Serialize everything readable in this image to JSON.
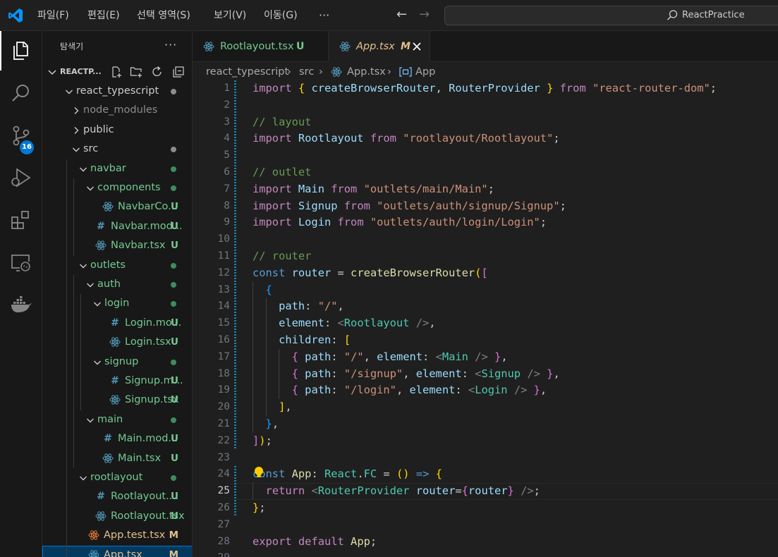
{
  "menu": {
    "items": [
      "파일(F)",
      "편집(E)",
      "선택 영역(S)",
      "보기(V)",
      "이동(G)"
    ],
    "more": "···",
    "back_arrow": "←",
    "forward_arrow": "→",
    "search_text": "ReactPractice"
  },
  "activity": {
    "scm_badge": "16"
  },
  "explorer": {
    "title": "탐색기",
    "more": "···",
    "workspace": "REACTP...",
    "items": [
      {
        "label": "react_typescript",
        "kind": "folder",
        "open": true,
        "status": "dot",
        "color": "#cccccc"
      },
      {
        "label": "node_modules",
        "kind": "folder",
        "open": false,
        "status": "",
        "color": "#8c8c8c"
      },
      {
        "label": "public",
        "kind": "folder",
        "open": false,
        "status": "",
        "color": "#cccccc"
      },
      {
        "label": "src",
        "kind": "folder",
        "open": true,
        "status": "dot",
        "color": "#cccccc"
      },
      {
        "label": "navbar",
        "kind": "folder",
        "open": true,
        "status": "dot-green",
        "color": "#73c991"
      },
      {
        "label": "components",
        "kind": "folder",
        "open": true,
        "status": "dot-green",
        "color": "#73c991"
      },
      {
        "label": "NavbarCo...",
        "kind": "react",
        "status": "U",
        "color": "#73c991"
      },
      {
        "label": "Navbar.mod...",
        "kind": "css",
        "status": "U",
        "color": "#73c991"
      },
      {
        "label": "Navbar.tsx",
        "kind": "react",
        "status": "U",
        "color": "#73c991"
      },
      {
        "label": "outlets",
        "kind": "folder",
        "open": true,
        "status": "dot-green",
        "color": "#73c991"
      },
      {
        "label": "auth",
        "kind": "folder",
        "open": true,
        "status": "dot-green",
        "color": "#73c991"
      },
      {
        "label": "login",
        "kind": "folder",
        "open": true,
        "status": "dot-green",
        "color": "#73c991"
      },
      {
        "label": "Login.mo...",
        "kind": "css",
        "status": "U",
        "color": "#73c991"
      },
      {
        "label": "Login.tsx",
        "kind": "react",
        "status": "U",
        "color": "#73c991"
      },
      {
        "label": "signup",
        "kind": "folder",
        "open": true,
        "status": "dot-green",
        "color": "#73c991"
      },
      {
        "label": "Signup.m...",
        "kind": "css",
        "status": "U",
        "color": "#73c991"
      },
      {
        "label": "Signup.tsx",
        "kind": "react",
        "status": "U",
        "color": "#73c991"
      },
      {
        "label": "main",
        "kind": "folder",
        "open": true,
        "status": "dot-green",
        "color": "#73c991"
      },
      {
        "label": "Main.mod...",
        "kind": "css",
        "status": "U",
        "color": "#73c991"
      },
      {
        "label": "Main.tsx",
        "kind": "react",
        "status": "U",
        "color": "#73c991"
      },
      {
        "label": "rootlayout",
        "kind": "folder",
        "open": true,
        "status": "dot-green",
        "color": "#73c991"
      },
      {
        "label": "Rootlayout....",
        "kind": "css",
        "status": "U",
        "color": "#73c991"
      },
      {
        "label": "Rootlayout.tsx",
        "kind": "react",
        "status": "U",
        "color": "#73c991"
      },
      {
        "label": "App.test.tsx",
        "kind": "test",
        "status": "M",
        "color": "#e2c08d"
      },
      {
        "label": "App.tsx",
        "kind": "react",
        "status": "M",
        "color": "#e2c08d",
        "selected": true
      }
    ]
  },
  "tabs": [
    {
      "name": "Rootlayout.tsx",
      "flag": "U",
      "active": false
    },
    {
      "name": "App.tsx",
      "flag": "M",
      "active": true
    }
  ],
  "breadcrumb": [
    "react_typescript",
    "src",
    "App.tsx",
    "App"
  ],
  "editor": {
    "current_line": 25,
    "lines": [
      [
        [
          "kw",
          "import"
        ],
        [
          "",
          "&nbsp;"
        ],
        [
          "b1",
          "{"
        ],
        [
          "",
          " "
        ],
        [
          "var",
          "createBrowserRouter"
        ],
        [
          "",
          ", "
        ],
        [
          "var",
          "RouterProvider"
        ],
        [
          "",
          " "
        ],
        [
          "b1",
          "}"
        ],
        [
          "",
          " "
        ],
        [
          "kw",
          "from"
        ],
        [
          "",
          " "
        ],
        [
          "str",
          "\"react-router-dom\""
        ],
        [
          "",
          ";"
        ]
      ],
      [],
      [
        [
          "cm",
          "// layout"
        ]
      ],
      [
        [
          "kw",
          "import"
        ],
        [
          "",
          " "
        ],
        [
          "var",
          "Rootlayout"
        ],
        [
          "",
          " "
        ],
        [
          "kw",
          "from"
        ],
        [
          "",
          " "
        ],
        [
          "str",
          "\"rootlayout/Rootlayout\""
        ],
        [
          "",
          ";"
        ]
      ],
      [],
      [
        [
          "cm",
          "// outlet"
        ]
      ],
      [
        [
          "kw",
          "import"
        ],
        [
          "",
          " "
        ],
        [
          "var",
          "Main"
        ],
        [
          "",
          " "
        ],
        [
          "kw",
          "from"
        ],
        [
          "",
          " "
        ],
        [
          "str",
          "\"outlets/main/Main\""
        ],
        [
          "",
          ";"
        ]
      ],
      [
        [
          "kw",
          "import"
        ],
        [
          "",
          " "
        ],
        [
          "var",
          "Signup"
        ],
        [
          "",
          " "
        ],
        [
          "kw",
          "from"
        ],
        [
          "",
          " "
        ],
        [
          "str",
          "\"outlets/auth/signup/Signup\""
        ],
        [
          "",
          ";"
        ]
      ],
      [
        [
          "kw",
          "import"
        ],
        [
          "",
          " "
        ],
        [
          "var",
          "Login"
        ],
        [
          "",
          " "
        ],
        [
          "kw",
          "from"
        ],
        [
          "",
          " "
        ],
        [
          "str",
          "\"outlets/auth/login/Login\""
        ],
        [
          "",
          ";"
        ]
      ],
      [],
      [
        [
          "cm",
          "// router"
        ]
      ],
      [
        [
          "kb",
          "const"
        ],
        [
          "",
          " "
        ],
        [
          "var",
          "router"
        ],
        [
          "",
          " = "
        ],
        [
          "fn",
          "createBrowserRouter"
        ],
        [
          "b1",
          "("
        ],
        [
          "b2",
          "["
        ]
      ],
      [
        [
          "",
          "  "
        ],
        [
          "b3",
          "{"
        ]
      ],
      [
        [
          "",
          "    "
        ],
        [
          "var",
          "path"
        ],
        [
          "",
          ": "
        ],
        [
          "str",
          "\"/\""
        ],
        [
          "",
          ","
        ]
      ],
      [
        [
          "",
          "    "
        ],
        [
          "var",
          "element"
        ],
        [
          "",
          ": "
        ],
        [
          "pu",
          "<"
        ],
        [
          "tag",
          "Rootlayout"
        ],
        [
          "",
          " "
        ],
        [
          "pu",
          "/>"
        ],
        [
          "",
          ","
        ]
      ],
      [
        [
          "",
          "    "
        ],
        [
          "var",
          "children"
        ],
        [
          "",
          ": "
        ],
        [
          "b1",
          "["
        ]
      ],
      [
        [
          "",
          "      "
        ],
        [
          "b2",
          "{"
        ],
        [
          "",
          " "
        ],
        [
          "var",
          "path"
        ],
        [
          "",
          ": "
        ],
        [
          "str",
          "\"/\""
        ],
        [
          "",
          ", "
        ],
        [
          "var",
          "element"
        ],
        [
          "",
          ": "
        ],
        [
          "pu",
          "<"
        ],
        [
          "tag",
          "Main"
        ],
        [
          "",
          " "
        ],
        [
          "pu",
          "/>"
        ],
        [
          "",
          " "
        ],
        [
          "b2",
          "}"
        ],
        [
          "",
          ","
        ]
      ],
      [
        [
          "",
          "      "
        ],
        [
          "b2",
          "{"
        ],
        [
          "",
          " "
        ],
        [
          "var",
          "path"
        ],
        [
          "",
          ": "
        ],
        [
          "str",
          "\"/signup\""
        ],
        [
          "",
          ", "
        ],
        [
          "var",
          "element"
        ],
        [
          "",
          ": "
        ],
        [
          "pu",
          "<"
        ],
        [
          "tag",
          "Signup"
        ],
        [
          "",
          " "
        ],
        [
          "pu",
          "/>"
        ],
        [
          "",
          " "
        ],
        [
          "b2",
          "}"
        ],
        [
          "",
          ","
        ]
      ],
      [
        [
          "",
          "      "
        ],
        [
          "b2",
          "{"
        ],
        [
          "",
          " "
        ],
        [
          "var",
          "path"
        ],
        [
          "",
          ": "
        ],
        [
          "str",
          "\"/login\""
        ],
        [
          "",
          ", "
        ],
        [
          "var",
          "element"
        ],
        [
          "",
          ": "
        ],
        [
          "pu",
          "<"
        ],
        [
          "tag",
          "Login"
        ],
        [
          "",
          " "
        ],
        [
          "pu",
          "/>"
        ],
        [
          "",
          " "
        ],
        [
          "b2",
          "}"
        ],
        [
          "",
          ","
        ]
      ],
      [
        [
          "",
          "    "
        ],
        [
          "b1",
          "]"
        ],
        [
          "",
          ","
        ]
      ],
      [
        [
          "",
          "  "
        ],
        [
          "b3",
          "}"
        ],
        [
          "",
          ","
        ]
      ],
      [
        [
          "b2",
          "]"
        ],
        [
          "b1",
          ")"
        ],
        [
          "",
          ";"
        ]
      ],
      [],
      [
        [
          "kb",
          "const"
        ],
        [
          "",
          " "
        ],
        [
          "fn",
          "App"
        ],
        [
          "",
          ": "
        ],
        [
          "tag",
          "React"
        ],
        [
          "",
          "."
        ],
        [
          "tag",
          "FC"
        ],
        [
          "",
          " = "
        ],
        [
          "b1",
          "()"
        ],
        [
          "",
          " "
        ],
        [
          "kb",
          "=>"
        ],
        [
          "",
          " "
        ],
        [
          "b1",
          "{"
        ]
      ],
      [
        [
          "",
          "  "
        ],
        [
          "kw",
          "return"
        ],
        [
          "",
          " "
        ],
        [
          "pu",
          "<"
        ],
        [
          "tag",
          "RouterProvider"
        ],
        [
          "",
          " "
        ],
        [
          "var",
          "router"
        ],
        [
          "",
          "="
        ],
        [
          "b2",
          "{"
        ],
        [
          "var",
          "router"
        ],
        [
          "b2",
          "}"
        ],
        [
          "",
          " "
        ],
        [
          "pu",
          "/>"
        ],
        [
          "",
          ";"
        ]
      ],
      [
        [
          "b1",
          "}"
        ],
        [
          "",
          ";"
        ]
      ],
      [],
      [
        [
          "kw",
          "export"
        ],
        [
          "",
          " "
        ],
        [
          "kw",
          "default"
        ],
        [
          "",
          " "
        ],
        [
          "fn",
          "App"
        ],
        [
          "",
          ";"
        ]
      ]
    ]
  }
}
